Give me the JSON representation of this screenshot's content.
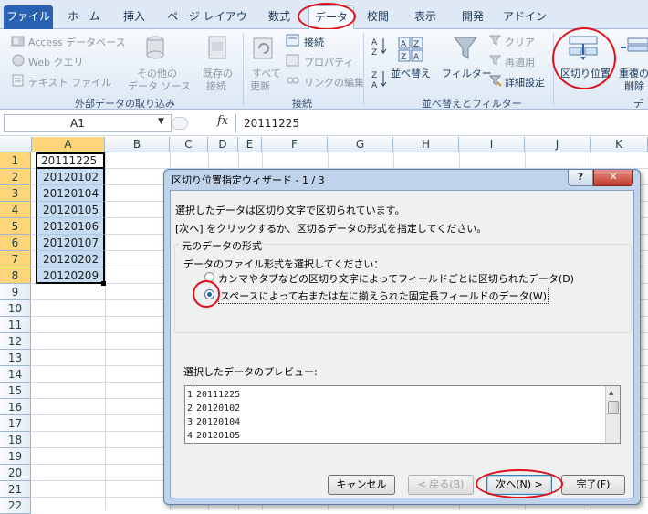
{
  "tabs": [
    "ファイル",
    "ホーム",
    "挿入",
    "ページ レイアウト",
    "数式",
    "データ",
    "校閲",
    "表示",
    "開発",
    "アドイン"
  ],
  "ribbon": {
    "ext": {
      "access": "Access データベース",
      "web": "Web クエリ",
      "text": "テキスト ファイル",
      "other1": "その他の",
      "other2": "データ ソース",
      "existing1": "既存の",
      "existing2": "接続",
      "group": "外部データの取り込み"
    },
    "conn": {
      "refresh1": "すべて",
      "refresh2": "更新",
      "connections": "接続",
      "properties": "プロパティ",
      "edit_links": "リンクの編集",
      "group": "接続"
    },
    "sort": {
      "sort": "並べ替え",
      "filter": "フィルター",
      "clear": "クリア",
      "reapply": "再適用",
      "advanced": "詳細設定",
      "group": "並べ替えとフィルター"
    },
    "tools": {
      "text_to_columns": "区切り位置",
      "remove_dup1": "重複の",
      "remove_dup2": "削除",
      "group": "デ"
    }
  },
  "formula": {
    "name_box": "A1",
    "fx": "fx",
    "value": "20111225"
  },
  "columns": [
    "A",
    "B",
    "C",
    "D",
    "E",
    "F",
    "G",
    "H",
    "I",
    "J",
    "K"
  ],
  "rows": [
    "1",
    "2",
    "3",
    "4",
    "5",
    "6",
    "7",
    "8",
    "9",
    "10",
    "11",
    "12",
    "13",
    "14",
    "15",
    "16",
    "17",
    "18",
    "19",
    "20",
    "21",
    "22"
  ],
  "cells_a": [
    "20111225",
    "20120102",
    "20120104",
    "20120105",
    "20120106",
    "20120107",
    "20120202",
    "20120209"
  ],
  "dialog": {
    "title": "区切り位置指定ウィザード - 1 / 3",
    "help": "?",
    "close": "✕",
    "line1": "選択したデータは区切り文字で区切られています。",
    "line2": "[次へ] をクリックするか、区切るデータの形式を指定してください。",
    "group_label": "元のデータの形式",
    "file_type_prompt": "データのファイル形式を選択してください：",
    "option_delimited": "カンマやタブなどの区切り文字によってフィールドごとに区切られたデータ(D)",
    "option_fixed": "スペースによって右または左に揃えられた固定長フィールドのデータ(W)",
    "preview_label": "選択したデータのプレビュー:",
    "preview_rows": [
      {
        "num": "1",
        "text": "20111225"
      },
      {
        "num": "2",
        "text": "20120102"
      },
      {
        "num": "3",
        "text": "20120104"
      },
      {
        "num": "4",
        "text": "20120105"
      }
    ],
    "cancel": "キャンセル",
    "back": "< 戻る(B)",
    "next": "次へ(N) >",
    "finish": "完了(F)"
  },
  "colors": {
    "file_tab": "#2a62b3",
    "selection": "#c5dcf2",
    "highlight_ring": "#e0101a",
    "header_sel": "#ffd57a"
  }
}
